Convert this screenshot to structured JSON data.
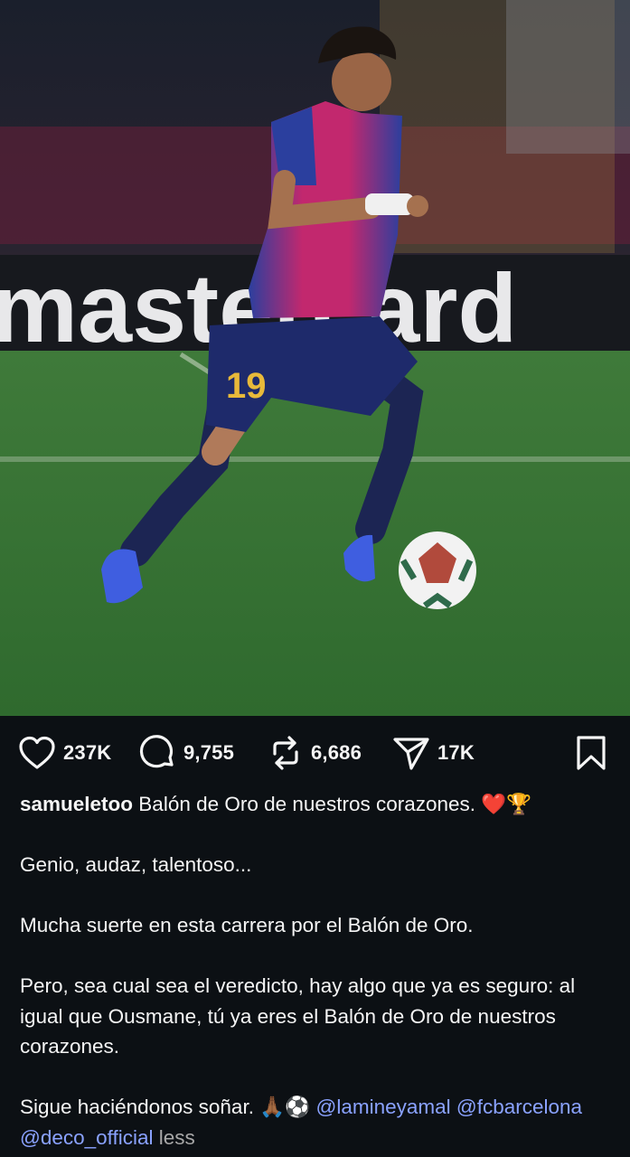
{
  "photo": {
    "alt_scene": "football-player-dribbling",
    "board_text": "mastercard",
    "shirt_number": "19"
  },
  "actions": {
    "like": {
      "icon": "heart-icon",
      "count": "237K"
    },
    "comment": {
      "icon": "comment-bubble-icon",
      "count": "9,755"
    },
    "repost": {
      "icon": "repost-icon",
      "count": "6,686"
    },
    "share": {
      "icon": "send-icon",
      "count": "17K"
    },
    "save": {
      "icon": "bookmark-icon"
    }
  },
  "caption": {
    "username": "samueletoo",
    "line1": " Balón de Oro de nuestros corazones. ",
    "line1_emojis": "❤️🏆",
    "p2": "Genio, audaz, talentoso...",
    "p3": "Mucha suerte en esta carrera por el Balón de Oro.",
    "p4": "Pero, sea cual sea el veredicto, hay algo que ya es seguro: al igual que Ousmane, tú ya eres el Balón de Oro de nuestros corazones.",
    "p5_text": "Sigue haciéndonos soñar. ",
    "p5_emojis": "🙏🏾⚽",
    "mentions": [
      "@lamineyamal",
      "@fcbarcelona",
      "@deco_official"
    ],
    "less_label": "less"
  },
  "colors": {
    "background": "#0c1014",
    "text": "#f5f5f5",
    "mention": "#8aa2ff",
    "muted": "#a8a8a8"
  }
}
